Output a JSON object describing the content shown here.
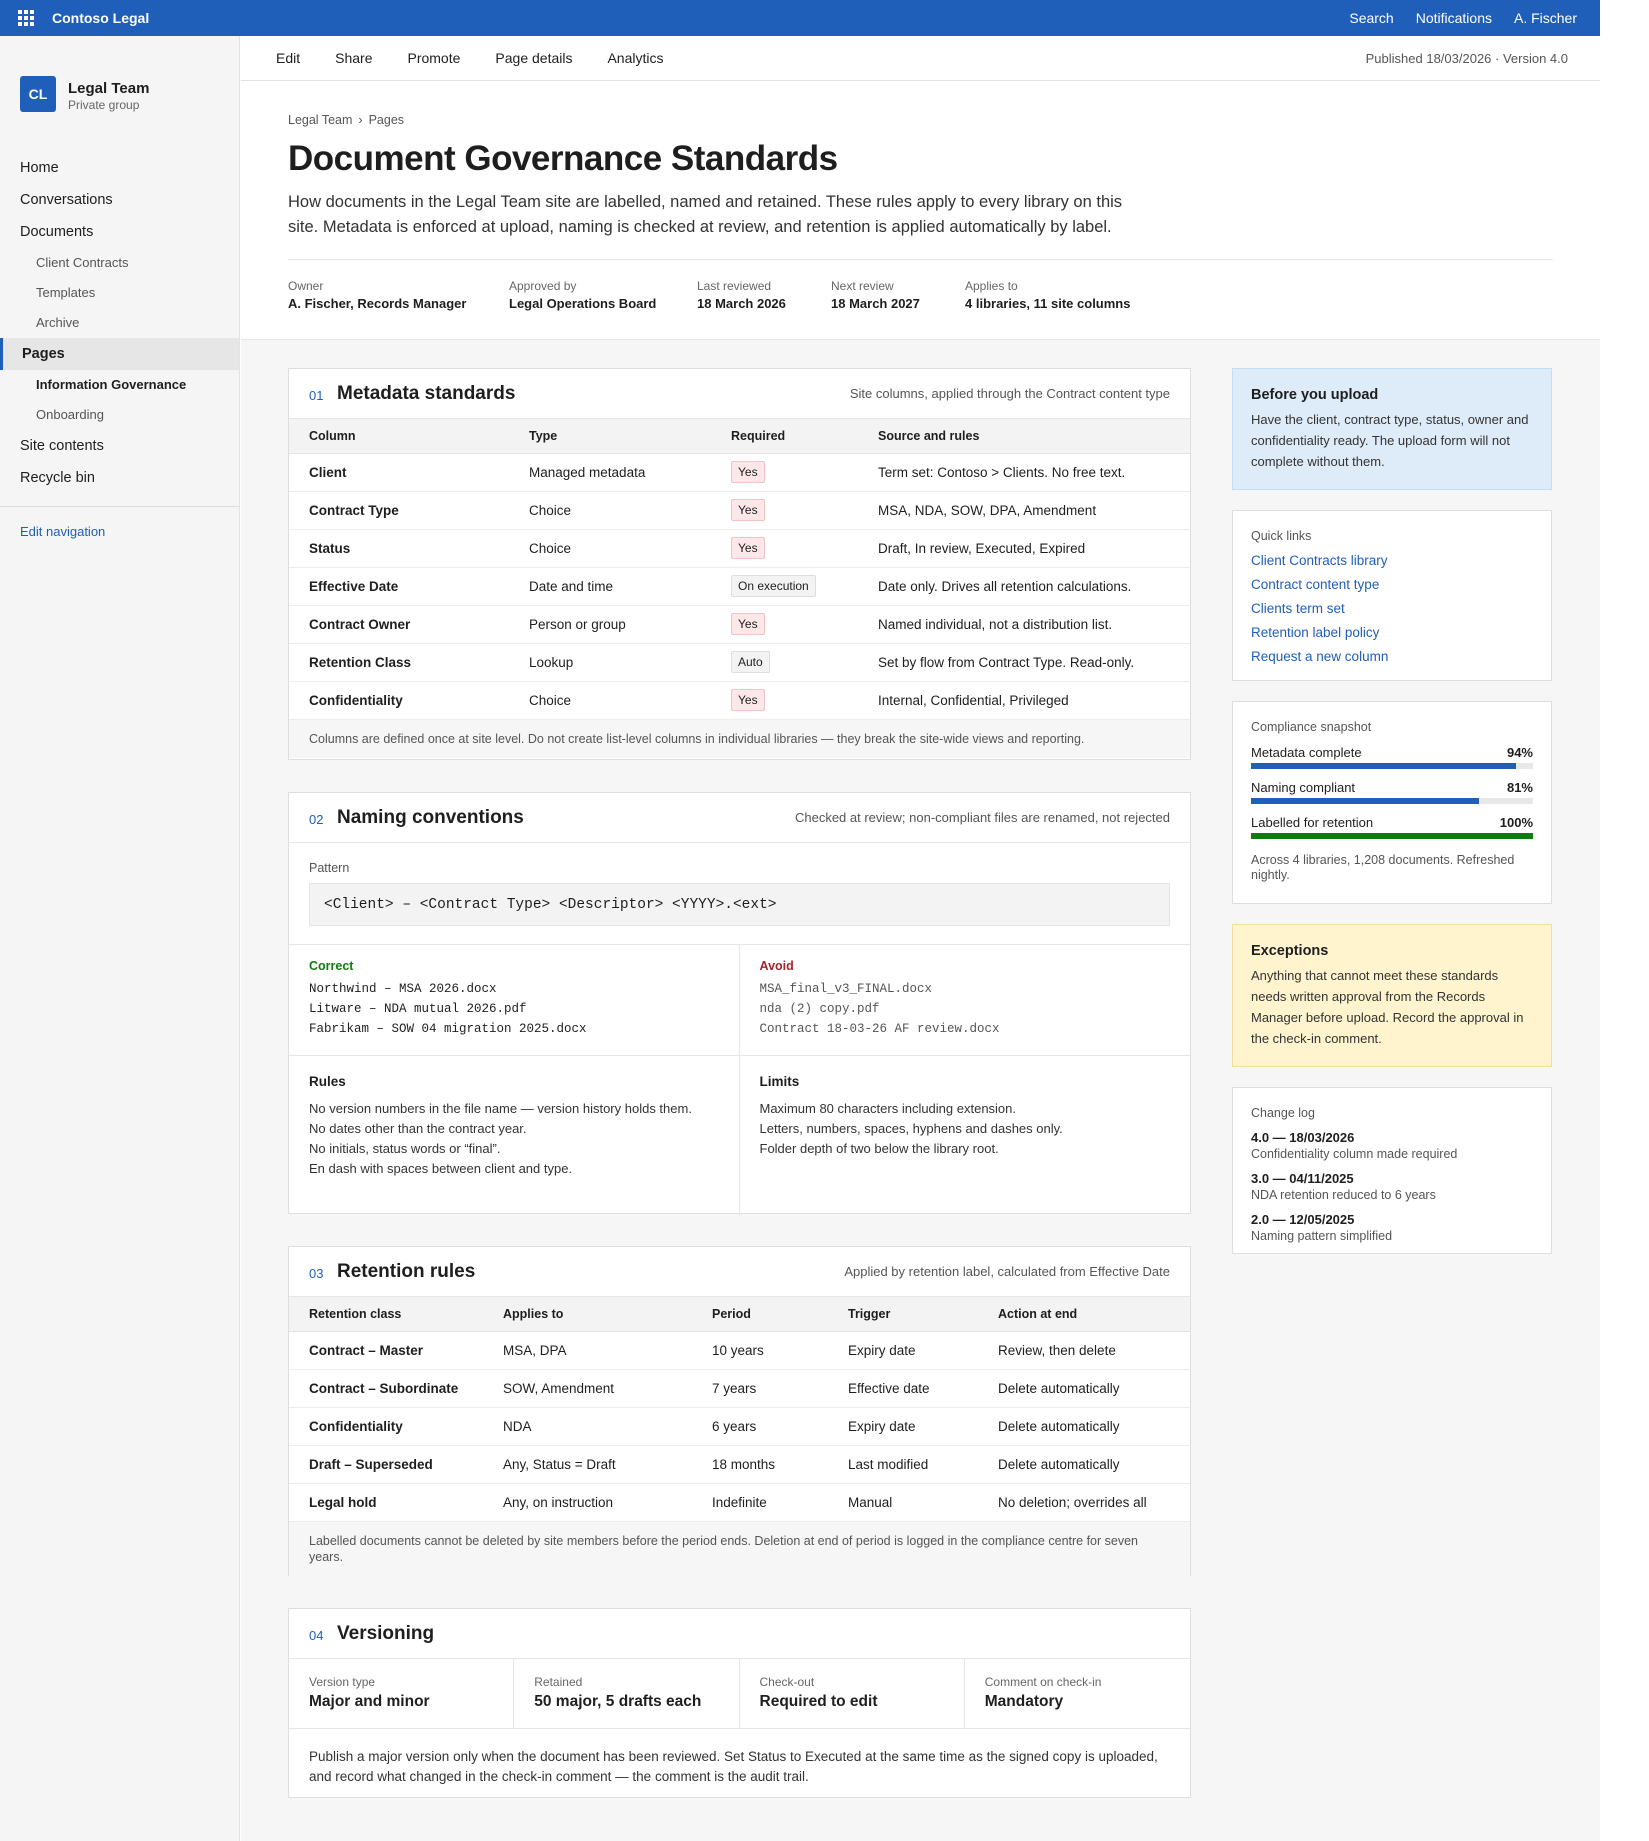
{
  "suitebar": {
    "title": "Contoso Legal",
    "links": [
      "Search",
      "Notifications",
      "A. Fischer"
    ]
  },
  "site": {
    "initials": "CL",
    "name": "Legal Team",
    "subtitle": "Private group"
  },
  "nav": {
    "items": [
      {
        "label": "Home"
      },
      {
        "label": "Conversations"
      },
      {
        "label": "Documents"
      },
      {
        "label": "Client Contracts"
      },
      {
        "label": "Templates"
      },
      {
        "label": "Archive"
      },
      {
        "label": "Pages"
      },
      {
        "label": "Information Governance"
      },
      {
        "label": "Onboarding"
      },
      {
        "label": "Site contents"
      },
      {
        "label": "Recycle bin"
      }
    ],
    "edit": "Edit navigation"
  },
  "commands": [
    "Edit",
    "Share",
    "Promote",
    "Page details",
    "Analytics"
  ],
  "publish_info": "Published 18/03/2026 · Version 4.0",
  "breadcrumb": [
    "Legal Team",
    "Pages"
  ],
  "breadcrumb_sep": "›",
  "page": {
    "title": "Document Governance Standards",
    "description": "How documents in the Legal Team site are labelled, named and retained. These rules apply to every library on this site. Metadata is enforced at upload, naming is checked at review, and retention is applied automatically by label."
  },
  "meta": [
    {
      "label": "Owner",
      "value": "A. Fischer, Records Manager"
    },
    {
      "label": "Approved by",
      "value": "Legal Operations Board"
    },
    {
      "label": "Last reviewed",
      "value": "18 March 2026"
    },
    {
      "label": "Next review",
      "value": "18 March 2027"
    },
    {
      "label": "Applies to",
      "value": "4 libraries, 11 site columns"
    }
  ],
  "metadata_section": {
    "num": "01",
    "title": "Metadata standards",
    "note": "Site columns, applied through the Contract content type",
    "headers": [
      "Column",
      "Type",
      "Required",
      "Source and rules"
    ],
    "rows": [
      [
        "Client",
        "Managed metadata",
        "Yes",
        "Term set: Contoso > Clients. No free text."
      ],
      [
        "Contract Type",
        "Choice",
        "Yes",
        "MSA, NDA, SOW, DPA, Amendment"
      ],
      [
        "Status",
        "Choice",
        "Yes",
        "Draft, In review, Executed, Expired"
      ],
      [
        "Effective Date",
        "Date and time",
        "On execution",
        "Date only. Drives all retention calculations."
      ],
      [
        "Contract Owner",
        "Person or group",
        "Yes",
        "Named individual, not a distribution list."
      ],
      [
        "Retention Class",
        "Lookup",
        "Auto",
        "Set by flow from Contract Type. Read-only."
      ],
      [
        "Confidentiality",
        "Choice",
        "Yes",
        "Internal, Confidential, Privileged"
      ]
    ],
    "footer": "Columns are defined once at site level. Do not create list-level columns in individual libraries — they break the site-wide views and reporting."
  },
  "naming_section": {
    "num": "02",
    "title": "Naming conventions",
    "note": "Checked at review; non-compliant files are renamed, not rejected",
    "pattern_label": "Pattern",
    "pattern": "<Client> – <Contract Type> <Descriptor> <YYYY>.<ext>",
    "correct_label": "Correct",
    "correct": [
      "Northwind – MSA 2026.docx",
      "Litware – NDA mutual 2026.pdf",
      "Fabrikam – SOW 04 migration 2025.docx"
    ],
    "avoid_label": "Avoid",
    "avoid": [
      "MSA_final_v3_FINAL.docx",
      "nda (2) copy.pdf",
      "Contract 18-03-26 AF review.docx"
    ],
    "rules_label": "Rules",
    "rules": [
      "No version numbers in the file name — version history holds them.",
      "No dates other than the contract year.",
      "No initials, status words or “final”.",
      "En dash with spaces between client and type."
    ],
    "limits_label": "Limits",
    "limits": [
      "Maximum 80 characters including extension.",
      "Letters, numbers, spaces, hyphens and dashes only.",
      "Folder depth of two below the library root."
    ]
  },
  "retention_section": {
    "num": "03",
    "title": "Retention rules",
    "note": "Applied by retention label, calculated from Effective Date",
    "headers": [
      "Retention class",
      "Applies to",
      "Period",
      "Trigger",
      "Action at end"
    ],
    "rows": [
      [
        "Contract – Master",
        "MSA, DPA",
        "10 years",
        "Expiry date",
        "Review, then delete"
      ],
      [
        "Contract – Subordinate",
        "SOW, Amendment",
        "7 years",
        "Effective date",
        "Delete automatically"
      ],
      [
        "Confidentiality",
        "NDA",
        "6 years",
        "Expiry date",
        "Delete automatically"
      ],
      [
        "Draft – Superseded",
        "Any, Status = Draft",
        "18 months",
        "Last modified",
        "Delete automatically"
      ],
      [
        "Legal hold",
        "Any, on instruction",
        "Indefinite",
        "Manual",
        "No deletion; overrides all"
      ]
    ],
    "footer": "Labelled documents cannot be deleted by site members before the period ends. Deletion at end of period is logged in the compliance centre for seven years."
  },
  "versioning_section": {
    "num": "04",
    "title": "Versioning",
    "facts": [
      {
        "label": "Version type",
        "value": "Major and minor"
      },
      {
        "label": "Retained",
        "value": "50 major, 5 drafts each"
      },
      {
        "label": "Check-out",
        "value": "Required to edit"
      },
      {
        "label": "Comment on check-in",
        "value": "Mandatory"
      }
    ],
    "text": "Publish a major version only when the document has been reviewed. Set Status to Executed at the same time as the signed copy is uploaded, and record what changed in the check-in comment — the comment is the audit trail."
  },
  "upload_box": {
    "title": "Before you upload",
    "text": "Have the client, contract type, status, owner and confidentiality ready. The upload form will not complete without them."
  },
  "quick_links": {
    "title": "Quick links",
    "links": [
      "Client Contracts library",
      "Contract content type",
      "Clients term set",
      "Retention label policy",
      "Request a new column"
    ]
  },
  "compliance": {
    "title": "Compliance snapshot",
    "items": [
      {
        "label": "Metadata complete",
        "value": "94%",
        "fraction": 0.94,
        "color": "#1f5fb9"
      },
      {
        "label": "Naming compliant",
        "value": "81%",
        "fraction": 0.81,
        "color": "#1f5fb9"
      },
      {
        "label": "Labelled for retention",
        "value": "100%",
        "fraction": 1.0,
        "color": "#107c10"
      }
    ],
    "note": "Across 4 libraries, 1,208 documents. Refreshed nightly."
  },
  "exceptions": {
    "title": "Exceptions",
    "text": "Anything that cannot meet these standards needs written approval from the Records Manager before upload. Record the approval in the check-in comment."
  },
  "changelog": {
    "title": "Change log",
    "entries": [
      {
        "version": "4.0 — 18/03/2026",
        "text": "Confidentiality column made required"
      },
      {
        "version": "3.0 — 04/11/2025",
        "text": "NDA retention reduced to 6 years"
      },
      {
        "version": "2.0 — 12/05/2025",
        "text": "Naming pattern simplified"
      }
    ]
  },
  "colors": {
    "accent": "#1f5fb9",
    "required_tag": "#fde7e9",
    "info_box": "#deebf8",
    "warning_box": "#fff4ce"
  }
}
